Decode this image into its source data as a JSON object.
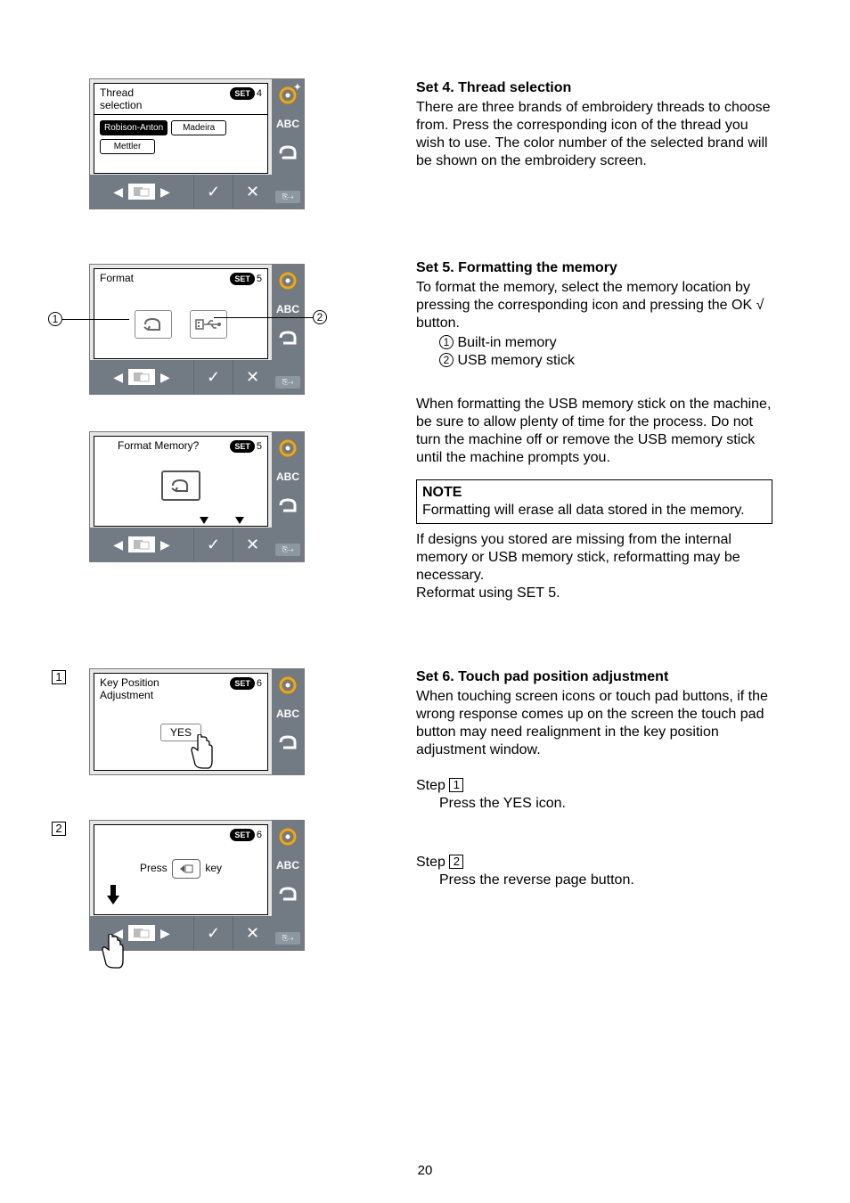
{
  "page_number": "20",
  "set4": {
    "heading": "Set 4. Thread selection",
    "body": "There are three brands of embroidery threads to choose from. Press the corresponding icon of the thread you wish to use. The color number of the selected brand will be shown on the embroidery screen.",
    "panel_title": "Thread\nselection",
    "set_badge": "SET",
    "set_num": "4",
    "options": [
      "Robison-Anton",
      "Madeira",
      "Mettler"
    ],
    "side_abc": "ABC"
  },
  "set5": {
    "heading": "Set 5. Formatting the memory",
    "body1": "To format the memory, select the memory location by pressing the corresponding icon and pressing the OK √ button.",
    "li1": "Built-in memory",
    "li2": "USB memory stick",
    "body2": "When formatting the USB memory stick on the machine, be sure to allow plenty of time for the process.  Do not turn the machine off or remove the USB memory stick until the machine prompts you.",
    "note_title": "NOTE",
    "note_body": "Formatting will erase all data stored in the memory.",
    "body3": "If designs you stored are missing from the internal memory or USB memory stick, reformatting may be necessary.",
    "body4": "Reformat using SET 5.",
    "panel1_title": "Format",
    "panel2_title": "Format Memory?",
    "set_badge": "SET",
    "set_num": "5",
    "side_abc": "ABC"
  },
  "set6": {
    "heading": "Set 6. Touch pad position adjustment",
    "body": "When touching screen icons or touch pad buttons, if the wrong response comes up on the screen the touch pad button may need realignment in the key position adjustment window.",
    "step1_label": "Step",
    "step1_num": "1",
    "step1_body": "Press the YES icon.",
    "step2_label": "Step",
    "step2_num": "2",
    "step2_body": "Press the reverse page button.",
    "panel1_title": "Key Position\nAdjustment",
    "yes": "YES",
    "panel2_press": "Press",
    "panel2_key": "key",
    "set_badge": "SET",
    "set_num": "6",
    "side_abc": "ABC",
    "left1": "1",
    "left2": "2"
  }
}
